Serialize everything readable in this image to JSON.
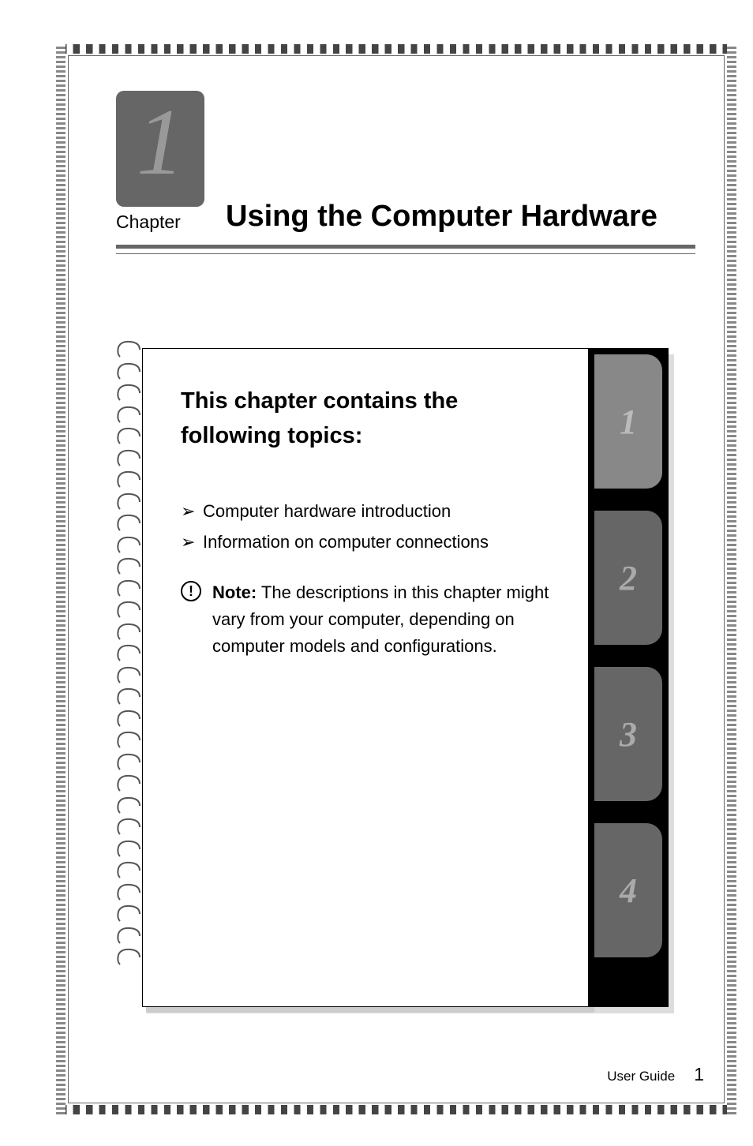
{
  "chapter": {
    "number": "1",
    "label": "Chapter",
    "title": "Using the Computer Hardware"
  },
  "content": {
    "heading": "This chapter contains the following topics:",
    "topics": [
      "Computer hardware introduction",
      "Information on computer connections"
    ],
    "note": {
      "label": "Note:",
      "text": " The descriptions in this chapter might vary from your computer, depending on computer models and configurations."
    }
  },
  "tabs": [
    {
      "number": "1",
      "active": true
    },
    {
      "number": "2",
      "active": false
    },
    {
      "number": "3",
      "active": false
    },
    {
      "number": "4",
      "active": false
    }
  ],
  "footer": {
    "label": "User Guide",
    "page": "1"
  }
}
